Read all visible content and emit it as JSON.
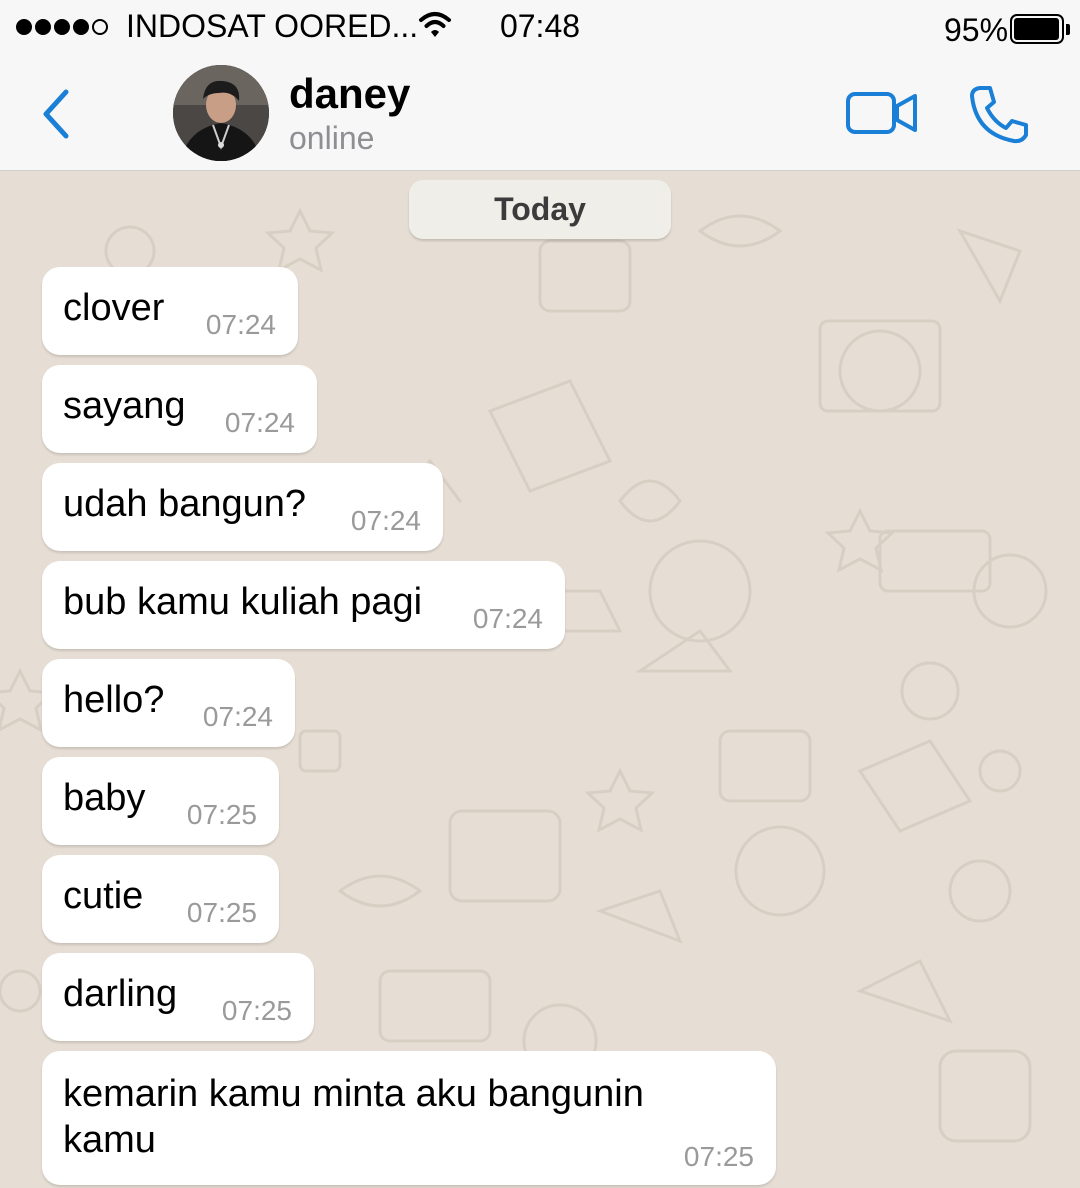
{
  "status_bar": {
    "carrier": "INDOSAT OORED...",
    "time": "07:48",
    "battery_percent": "95%",
    "battery_level": 0.95,
    "signal_bars": 4,
    "signal_total": 5
  },
  "header": {
    "contact_name": "daney",
    "contact_status": "online",
    "accent_color": "#1a7fd6",
    "icons": [
      "chevron-left-icon",
      "video-camera-icon",
      "phone-icon"
    ]
  },
  "chat": {
    "date_label": "Today",
    "messages": [
      {
        "text": "clover",
        "time": "07:24"
      },
      {
        "text": "sayang",
        "time": "07:24"
      },
      {
        "text": "udah bangun?",
        "time": "07:24"
      },
      {
        "text": "bub kamu kuliah pagi",
        "time": "07:24"
      },
      {
        "text": "hello?",
        "time": "07:24"
      },
      {
        "text": "baby",
        "time": "07:25"
      },
      {
        "text": "cutie",
        "time": "07:25"
      },
      {
        "text": "darling",
        "time": "07:25"
      },
      {
        "text_line1": "kemarin kamu minta aku bangunin",
        "text_line2": "kamu",
        "time": "07:25"
      }
    ]
  }
}
